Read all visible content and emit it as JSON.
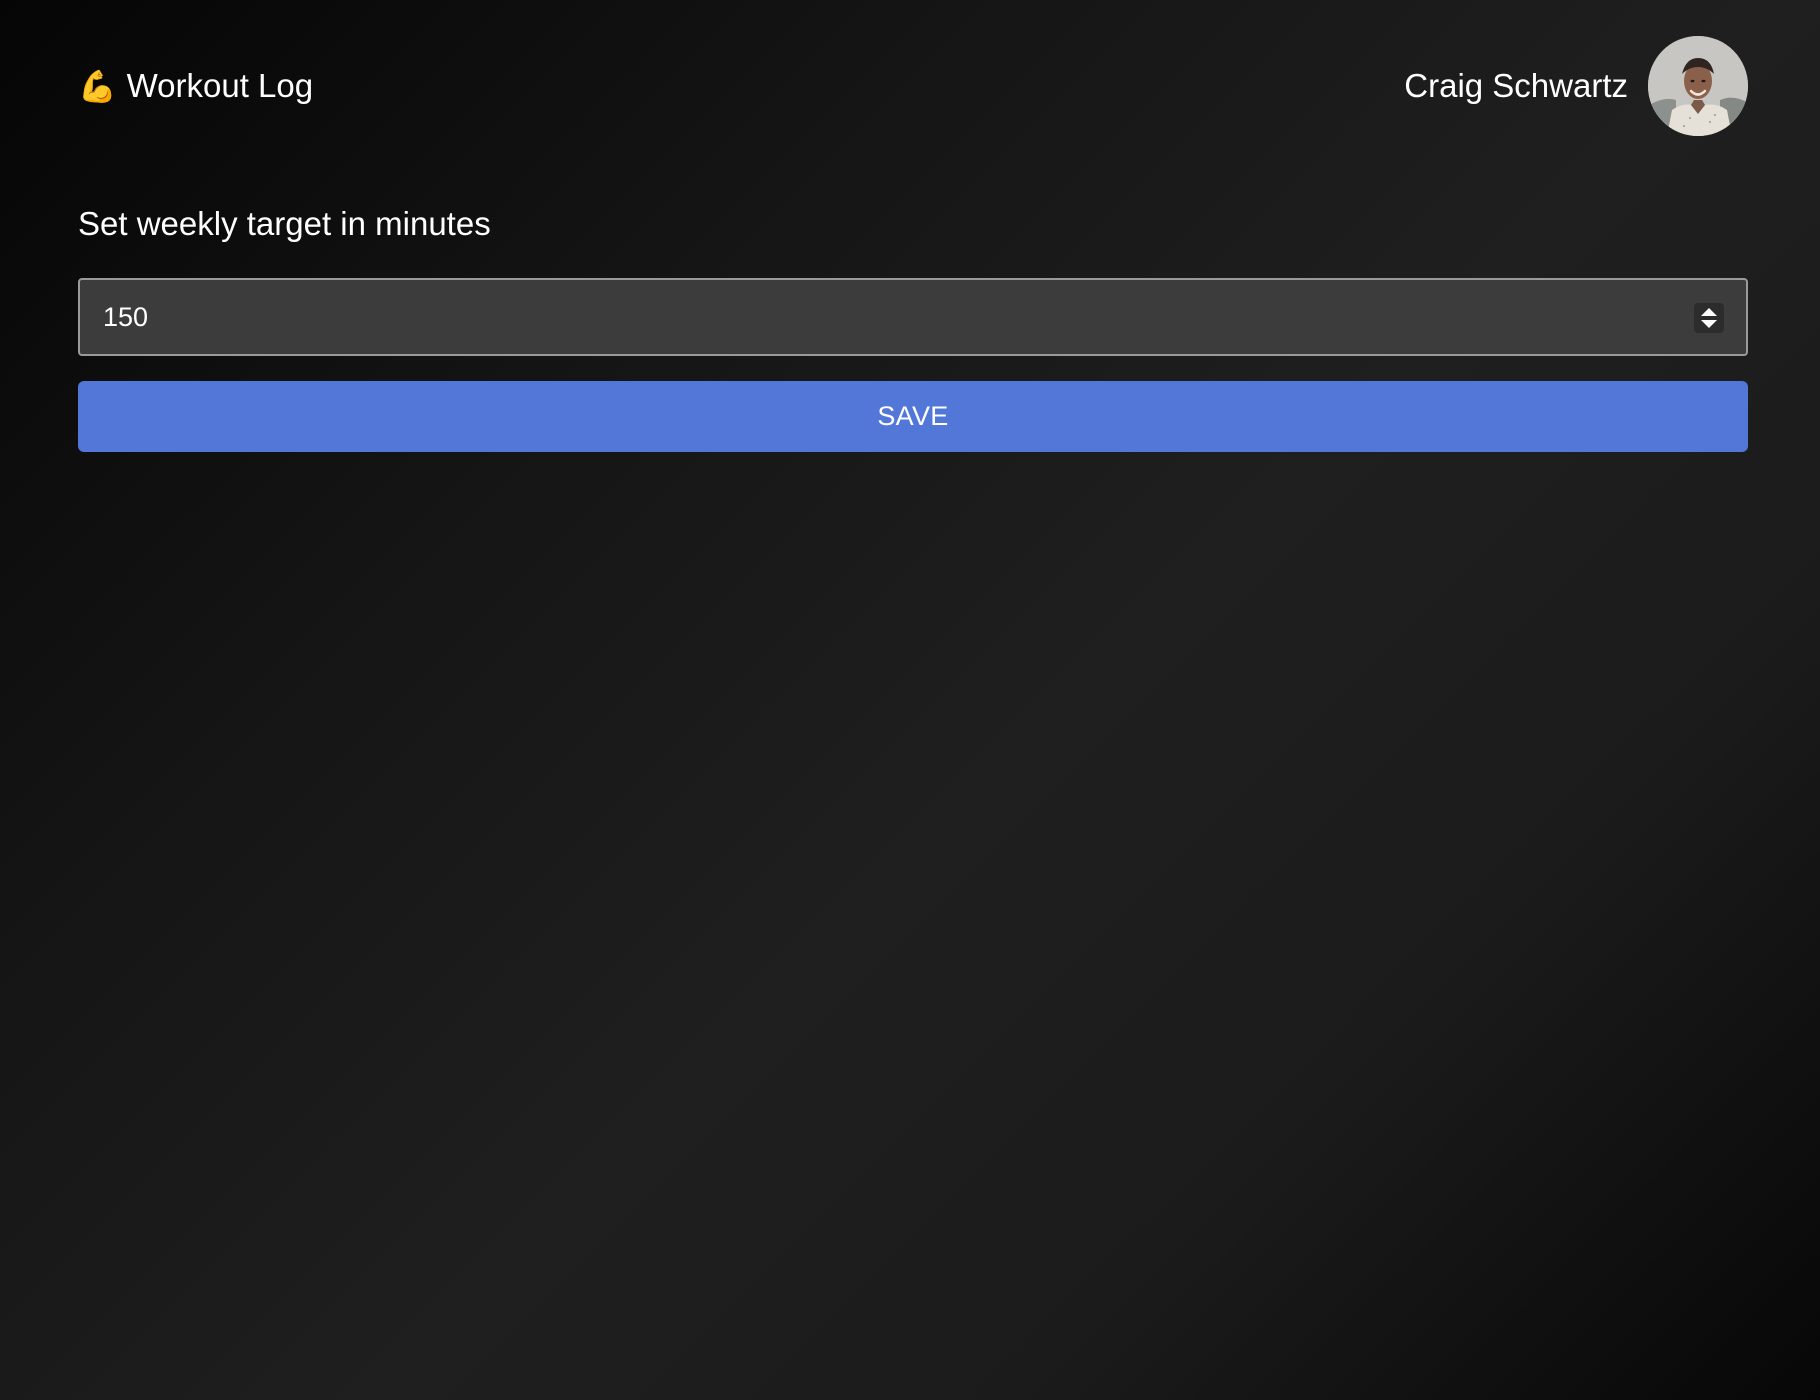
{
  "header": {
    "brand_icon": "💪",
    "brand_title": "Workout Log",
    "user_name": "Craig Schwartz",
    "avatar_alt": "Craig Schwartz"
  },
  "target": {
    "label": "Set weekly target in minutes",
    "value": "150"
  },
  "actions": {
    "save_label": "SAVE"
  },
  "colors": {
    "accent": "#5277d9",
    "input_background": "#3c3c3c",
    "text": "#ffffff"
  }
}
